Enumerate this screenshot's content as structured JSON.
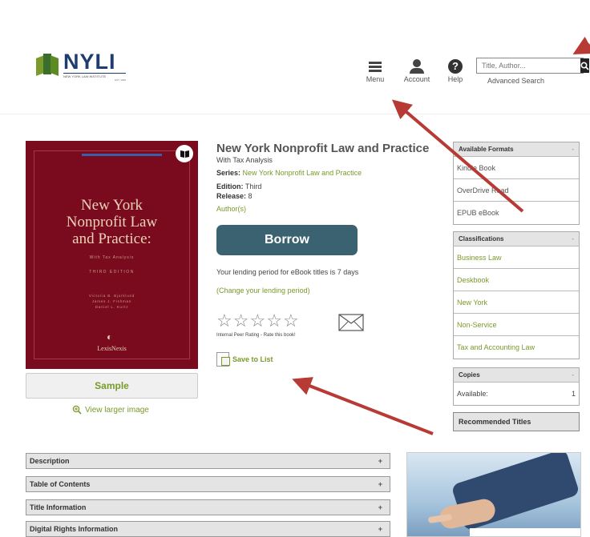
{
  "header": {
    "logo_text": "NYLI",
    "logo_subtitle": "NEW YORK LAW INSTITUTE",
    "logo_est": "EST. 1828",
    "nav": {
      "menu_label": "Menu",
      "account_label": "Account",
      "help_label": "Help"
    },
    "search": {
      "placeholder": "Title, Author...",
      "advanced_label": "Advanced Search"
    }
  },
  "cover": {
    "title_line1": "New York",
    "title_line2": "Nonprofit Law",
    "title_line3": "and Practice:",
    "subtitle": "With Tax Analysis",
    "edition": "THIRD EDITION",
    "author1": "Victoria B. Bjorklund",
    "author2": "James J. Fishman",
    "author3": "Daniel L. Kurtz",
    "publisher": "LexisNexis"
  },
  "sample_label": "Sample",
  "view_larger_label": "View larger image",
  "book": {
    "title": "New York Nonprofit Law and Practice",
    "subtitle": "With Tax Analysis",
    "series_label": "Series:",
    "series_value": "New York Nonprofit Law and Practice",
    "edition_label": "Edition:",
    "edition_value": "Third",
    "release_label": "Release:",
    "release_value": "8",
    "authors_link": "Author(s)"
  },
  "borrow_label": "Borrow",
  "lending": {
    "text": "Your lending period for eBook titles is 7 days",
    "change_link": "(Change your lending period)"
  },
  "rating": {
    "stars_filled": 0,
    "stars_total": 5,
    "caption": "Internal Peer Rating - Rate this book!"
  },
  "save_to_list_label": "Save to List",
  "sidebar": {
    "formats": {
      "heading": "Available Formats",
      "toggle": "-",
      "items": [
        "Kindle Book",
        "OverDrive Read",
        "EPUB eBook"
      ]
    },
    "classifications": {
      "heading": "Classifications",
      "toggle": "-",
      "items": [
        "Business Law",
        "Deskbook",
        "New York",
        "Non-Service",
        "Tax and Accounting Law"
      ]
    },
    "copies": {
      "heading": "Copies",
      "toggle": "-",
      "available_label": "Available:",
      "available_value": "1"
    },
    "recommended_label": "Recommended Titles"
  },
  "accordions": [
    {
      "label": "Description",
      "toggle": "+"
    },
    {
      "label": "Table of Contents",
      "toggle": "+"
    },
    {
      "label": "Title Information",
      "toggle": "+"
    },
    {
      "label": "Digital Rights Information",
      "toggle": "+"
    }
  ],
  "colors": {
    "brand_green": "#7a9a2a",
    "borrow_button": "#3b6270",
    "cover": "#7a0a1e",
    "annotation_arrow": "#b83a35"
  }
}
